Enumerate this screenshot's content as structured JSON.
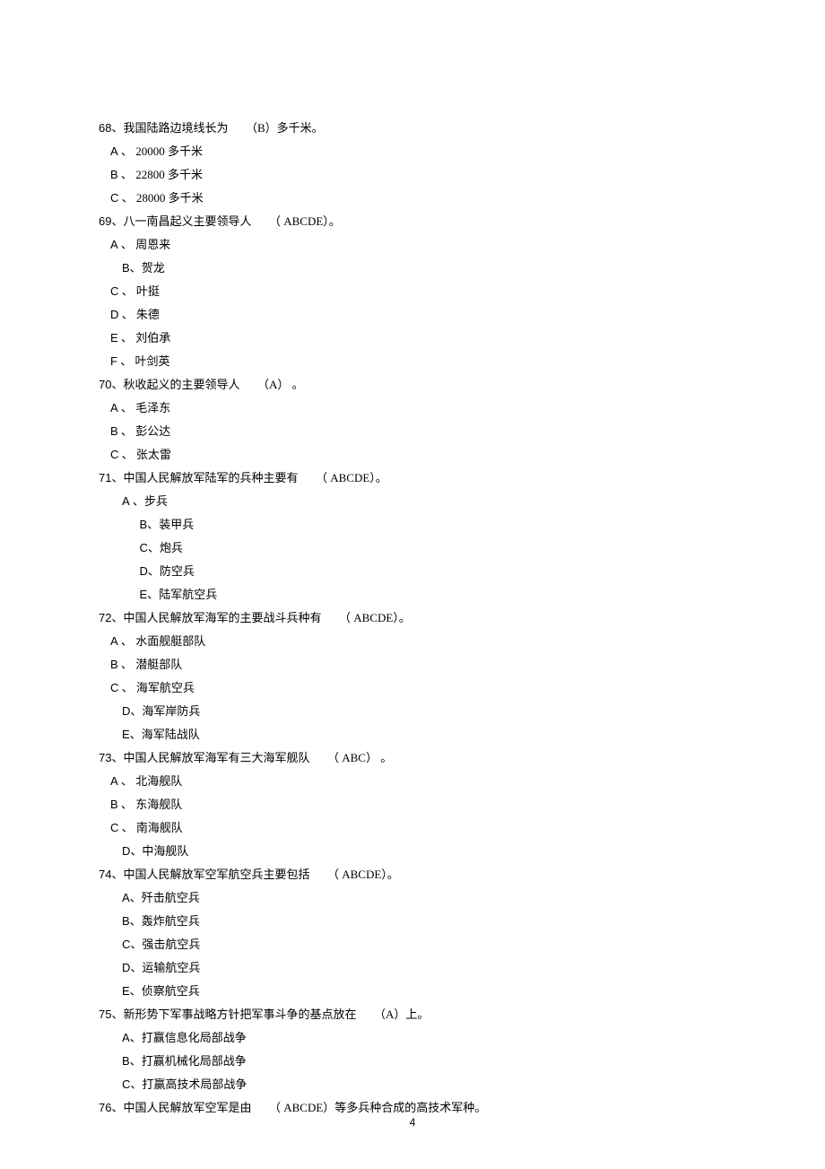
{
  "page_number": "4",
  "questions": [
    {
      "num": "68",
      "stem_a": "、我国陆路边境线长为",
      "ans": "（B）",
      "stem_b": "多千米。",
      "opt_style": "opt-line",
      "options": [
        {
          "letter": "A",
          "sep": " 、 ",
          "text": "20000 多千米"
        },
        {
          "letter": "B",
          "sep": " 、 ",
          "text": "22800 多千米"
        },
        {
          "letter": "C",
          "sep": " 、 ",
          "text": "28000 多千米"
        }
      ]
    },
    {
      "num": "69",
      "stem_a": "、八一南昌起义主要领导人",
      "ans": "（ ABCDE）",
      "stem_b": "。",
      "opt_style": "opt-line",
      "options": [
        {
          "letter": "A",
          "sep": " 、 ",
          "text": "周恩来"
        },
        {
          "letter": "B",
          "sep": "、",
          "text": "贺龙",
          "indent": "opt-line-2"
        },
        {
          "letter": "C",
          "sep": " 、 ",
          "text": "叶挺"
        },
        {
          "letter": "D",
          "sep": " 、 ",
          "text": "朱德"
        },
        {
          "letter": "E",
          "sep": " 、 ",
          "text": "刘伯承"
        },
        {
          "letter": "F",
          "sep": " 、 ",
          "text": "叶剑英"
        }
      ]
    },
    {
      "num": "70",
      "stem_a": "、秋收起义的主要领导人",
      "ans": "（A）",
      "stem_b": " 。",
      "opt_style": "opt-line",
      "options": [
        {
          "letter": "A",
          "sep": " 、 ",
          "text": "毛泽东"
        },
        {
          "letter": "B",
          "sep": " 、 ",
          "text": "彭公达"
        },
        {
          "letter": "C",
          "sep": " 、 ",
          "text": "张太雷"
        }
      ]
    },
    {
      "num": "71",
      "stem_a": "、中国人民解放军陆军的兵种主要有",
      "ans": "（ ABCDE）",
      "stem_b": "。",
      "opt_style": "opt-line-3",
      "first_opt_style": "opt-line-2",
      "options": [
        {
          "letter": "A",
          "sep": "  、",
          "text": "步兵",
          "indent": "opt-line-2"
        },
        {
          "letter": "B",
          "sep": "、",
          "text": "装甲兵"
        },
        {
          "letter": "C",
          "sep": "、",
          "text": "炮兵"
        },
        {
          "letter": "D",
          "sep": "、",
          "text": "防空兵"
        },
        {
          "letter": "E",
          "sep": "、",
          "text": "陆军航空兵"
        }
      ]
    },
    {
      "num": "72",
      "stem_a": "、中国人民解放军海军的主要战斗兵种有",
      "ans": "（ ABCDE）",
      "stem_b": "。",
      "opt_style": "opt-line",
      "options": [
        {
          "letter": "A",
          "sep": " 、 ",
          "text": "水面舰艇部队"
        },
        {
          "letter": "B",
          "sep": " 、 ",
          "text": "潜艇部队"
        },
        {
          "letter": "C",
          "sep": " 、 ",
          "text": "海军航空兵"
        },
        {
          "letter": "D",
          "sep": "、",
          "text": "海军岸防兵",
          "indent": "opt-line-2"
        },
        {
          "letter": "E",
          "sep": "、",
          "text": "海军陆战队",
          "indent": "opt-line-2"
        }
      ]
    },
    {
      "num": "73",
      "stem_a": "、中国人民解放军海军有三大海军舰队",
      "ans": "（ ABC）",
      "stem_b": " 。",
      "opt_style": "opt-line",
      "options": [
        {
          "letter": "A",
          "sep": " 、 ",
          "text": "北海舰队"
        },
        {
          "letter": "B",
          "sep": " 、 ",
          "text": "东海舰队"
        },
        {
          "letter": "C",
          "sep": " 、 ",
          "text": "南海舰队"
        },
        {
          "letter": "D",
          "sep": "、",
          "text": "中海舰队",
          "indent": "opt-line-2"
        }
      ]
    },
    {
      "num": "74",
      "stem_a": "、中国人民解放军空军航空兵主要包括",
      "ans": "（ ABCDE）",
      "stem_b": "。",
      "opt_style": "opt-line-2",
      "options": [
        {
          "letter": "A",
          "sep": "、",
          "text": "歼击航空兵"
        },
        {
          "letter": "B",
          "sep": "、",
          "text": "轰炸航空兵"
        },
        {
          "letter": "C",
          "sep": "、",
          "text": "强击航空兵"
        },
        {
          "letter": "D",
          "sep": "、",
          "text": "运输航空兵"
        },
        {
          "letter": "E",
          "sep": "、",
          "text": "侦察航空兵"
        }
      ]
    },
    {
      "num": "75",
      "stem_a": "、新形势下军事战略方针把军事斗争的基点放在",
      "ans": "（A）",
      "stem_b": "上。",
      "opt_style": "opt-line-2",
      "options": [
        {
          "letter": "A",
          "sep": "、",
          "text": "打赢信息化局部战争"
        },
        {
          "letter": "B",
          "sep": "、",
          "text": "打赢机械化局部战争"
        },
        {
          "letter": "C",
          "sep": "、",
          "text": "打赢高技术局部战争"
        }
      ]
    },
    {
      "num": "76",
      "stem_a": "、中国人民解放军空军是由",
      "ans": "（ ABCDE）",
      "stem_b": "等多兵种合成的高技术军种。",
      "opt_style": "opt-line",
      "options": []
    }
  ]
}
